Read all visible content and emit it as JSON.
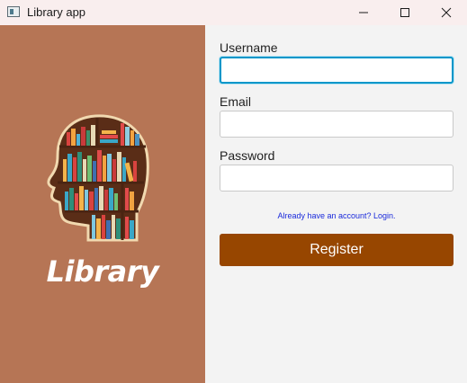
{
  "window": {
    "title": "Library app"
  },
  "brand": {
    "name": "Library"
  },
  "form": {
    "username_label": "Username",
    "username_value": "",
    "email_label": "Email",
    "email_value": "",
    "password_label": "Password",
    "password_value": "",
    "login_link": "Already have an account? Login.",
    "register_label": "Register"
  },
  "colors": {
    "left_panel": "#b67555",
    "register_button": "#974600",
    "link": "#1a2adb",
    "focus_border": "#0096c9"
  },
  "icons": [
    "app-icon",
    "minimize-icon",
    "maximize-icon",
    "close-icon",
    "library-head-logo"
  ]
}
